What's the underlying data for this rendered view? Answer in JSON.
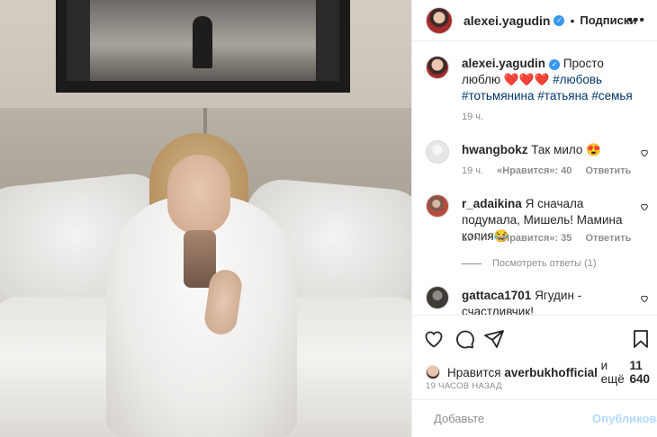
{
  "post": {
    "author": "alexei.yagudin",
    "follow_separator": "•",
    "follow_label": "Подписки",
    "more_label": "•••",
    "verified_mark": "✓",
    "caption_text": "Просто люблю ",
    "caption_emoji": "❤️❤️❤️",
    "hashtags": [
      "#любовь",
      "#тотьмянина",
      "#татьяна",
      "#семья"
    ],
    "caption_time": "19 ч."
  },
  "comments": [
    {
      "username": "hwangbokz",
      "text": "Так мило 😍",
      "time": "19 ч.",
      "likes": "«Нравится»: 40",
      "reply": "Ответить"
    },
    {
      "username": "r_adaikina",
      "text": "Я сначала подумала, Мишель! Мамина копия😂",
      "time": "19 ч.",
      "likes": "«Нравится»: 35",
      "reply": "Ответить",
      "view_replies": "Посмотреть ответы (1)"
    },
    {
      "username": "gattaca1701",
      "text": "Ягудин - счастливчик!"
    }
  ],
  "likes": {
    "prefix": "Нравится",
    "user": "averbukhofficial",
    "suffix": "и ещё",
    "count": "11 640"
  },
  "timestamp": "19 ЧАСОВ НАЗАД",
  "add_comment": {
    "placeholder": "Добавьте",
    "publish": "Опубликовать"
  },
  "icons": [
    "heart-icon",
    "comment-icon",
    "share-icon",
    "bookmark-icon",
    "emoji-icon",
    "more-icon",
    "verified-icon"
  ],
  "colors": {
    "link": "#00376b",
    "verified": "#3897f0",
    "publish_disabled": "#b3dbff",
    "muted": "#8e8e8e"
  }
}
